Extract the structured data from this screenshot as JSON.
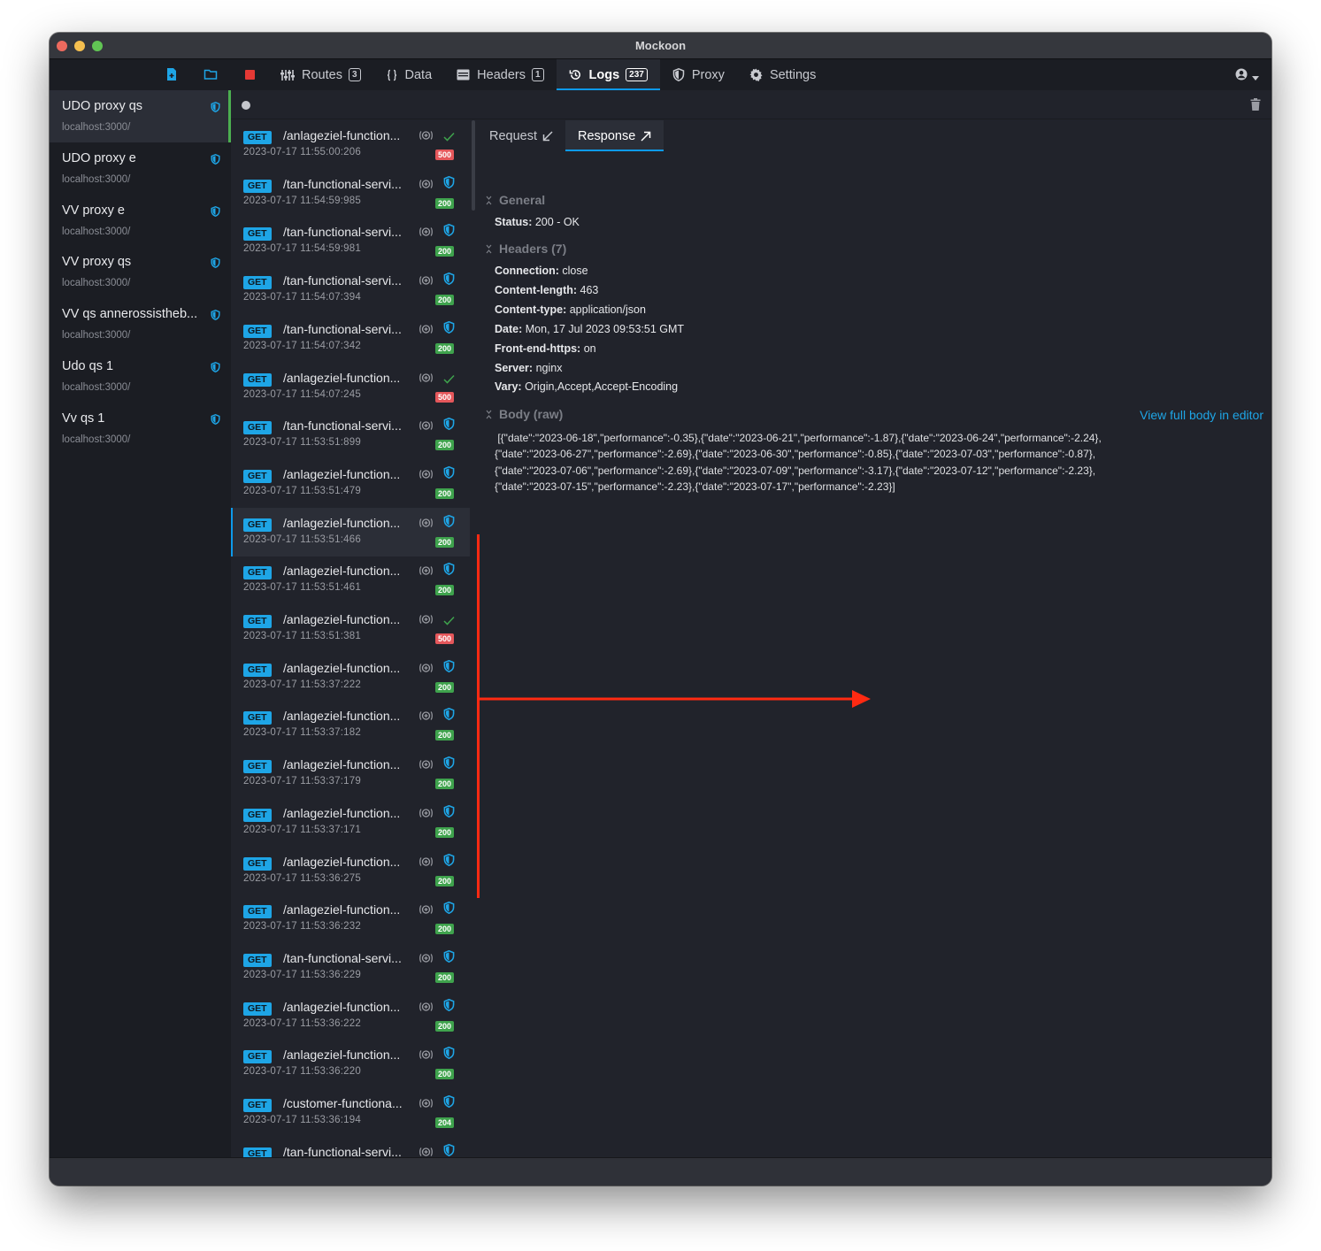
{
  "app": {
    "title": "Mockoon"
  },
  "nav": {
    "routes": {
      "label": "Routes",
      "count": "3"
    },
    "data": {
      "label": "Data"
    },
    "headers": {
      "label": "Headers",
      "count": "1"
    },
    "logs": {
      "label": "Logs",
      "count": "237"
    },
    "proxy": {
      "label": "Proxy"
    },
    "settings": {
      "label": "Settings"
    }
  },
  "environments": [
    {
      "name": "UDO proxy qs",
      "url": "localhost:3000/"
    },
    {
      "name": "UDO proxy e",
      "url": "localhost:3000/"
    },
    {
      "name": "VV proxy e",
      "url": "localhost:3000/"
    },
    {
      "name": "VV proxy qs",
      "url": "localhost:3000/"
    },
    {
      "name": "VV qs annerossistheb...",
      "url": "localhost:3000/"
    },
    {
      "name": "Udo qs 1",
      "url": "localhost:3000/"
    },
    {
      "name": "Vv qs 1",
      "url": "localhost:3000/"
    }
  ],
  "logs": [
    {
      "method": "GET",
      "route": "/anlageziel-function...",
      "ts": "2023-07-17 11:55:00:206",
      "status": "500",
      "state": "check"
    },
    {
      "method": "GET",
      "route": "/tan-functional-servi...",
      "ts": "2023-07-17 11:54:59:985",
      "status": "200",
      "state": "shield"
    },
    {
      "method": "GET",
      "route": "/tan-functional-servi...",
      "ts": "2023-07-17 11:54:59:981",
      "status": "200",
      "state": "shield"
    },
    {
      "method": "GET",
      "route": "/tan-functional-servi...",
      "ts": "2023-07-17 11:54:07:394",
      "status": "200",
      "state": "shield"
    },
    {
      "method": "GET",
      "route": "/tan-functional-servi...",
      "ts": "2023-07-17 11:54:07:342",
      "status": "200",
      "state": "shield"
    },
    {
      "method": "GET",
      "route": "/anlageziel-function...",
      "ts": "2023-07-17 11:54:07:245",
      "status": "500",
      "state": "check"
    },
    {
      "method": "GET",
      "route": "/tan-functional-servi...",
      "ts": "2023-07-17 11:53:51:899",
      "status": "200",
      "state": "shield"
    },
    {
      "method": "GET",
      "route": "/anlageziel-function...",
      "ts": "2023-07-17 11:53:51:479",
      "status": "200",
      "state": "shield"
    },
    {
      "method": "GET",
      "route": "/anlageziel-function...",
      "ts": "2023-07-17 11:53:51:466",
      "status": "200",
      "state": "shield"
    },
    {
      "method": "GET",
      "route": "/anlageziel-function...",
      "ts": "2023-07-17 11:53:51:461",
      "status": "200",
      "state": "shield"
    },
    {
      "method": "GET",
      "route": "/anlageziel-function...",
      "ts": "2023-07-17 11:53:51:381",
      "status": "500",
      "state": "check"
    },
    {
      "method": "GET",
      "route": "/anlageziel-function...",
      "ts": "2023-07-17 11:53:37:222",
      "status": "200",
      "state": "shield"
    },
    {
      "method": "GET",
      "route": "/anlageziel-function...",
      "ts": "2023-07-17 11:53:37:182",
      "status": "200",
      "state": "shield"
    },
    {
      "method": "GET",
      "route": "/anlageziel-function...",
      "ts": "2023-07-17 11:53:37:179",
      "status": "200",
      "state": "shield"
    },
    {
      "method": "GET",
      "route": "/anlageziel-function...",
      "ts": "2023-07-17 11:53:37:171",
      "status": "200",
      "state": "shield"
    },
    {
      "method": "GET",
      "route": "/anlageziel-function...",
      "ts": "2023-07-17 11:53:36:275",
      "status": "200",
      "state": "shield"
    },
    {
      "method": "GET",
      "route": "/anlageziel-function...",
      "ts": "2023-07-17 11:53:36:232",
      "status": "200",
      "state": "shield"
    },
    {
      "method": "GET",
      "route": "/tan-functional-servi...",
      "ts": "2023-07-17 11:53:36:229",
      "status": "200",
      "state": "shield"
    },
    {
      "method": "GET",
      "route": "/anlageziel-function...",
      "ts": "2023-07-17 11:53:36:222",
      "status": "200",
      "state": "shield"
    },
    {
      "method": "GET",
      "route": "/anlageziel-function...",
      "ts": "2023-07-17 11:53:36:220",
      "status": "200",
      "state": "shield"
    },
    {
      "method": "GET",
      "route": "/customer-functiona...",
      "ts": "2023-07-17 11:53:36:194",
      "status": "204",
      "state": "shield"
    },
    {
      "method": "GET",
      "route": "/tan-functional-servi...",
      "ts": "",
      "status": "",
      "state": "shield"
    }
  ],
  "detail": {
    "tabs": {
      "request": "Request",
      "response": "Response"
    },
    "general": {
      "title": "General",
      "status_key": "Status:",
      "status_val": "200 - OK"
    },
    "headers": {
      "title": "Headers (7)",
      "items": [
        {
          "k": "Connection:",
          "v": "close"
        },
        {
          "k": "Content-length:",
          "v": "463"
        },
        {
          "k": "Content-type:",
          "v": "application/json"
        },
        {
          "k": "Date:",
          "v": "Mon, 17 Jul 2023 09:53:51 GMT"
        },
        {
          "k": "Front-end-https:",
          "v": "on"
        },
        {
          "k": "Server:",
          "v": "nginx"
        },
        {
          "k": "Vary:",
          "v": "Origin,Accept,Accept-Encoding"
        }
      ]
    },
    "body": {
      "title": "Body (raw)",
      "link": "View full body in editor",
      "raw": " [{\"date\":\"2023-06-18\",\"performance\":-0.35},{\"date\":\"2023-06-21\",\"performance\":-1.87},{\"date\":\"2023-06-24\",\"performance\":-2.24},\n{\"date\":\"2023-06-27\",\"performance\":-2.69},{\"date\":\"2023-06-30\",\"performance\":-0.85},{\"date\":\"2023-07-03\",\"performance\":-0.87},\n{\"date\":\"2023-07-06\",\"performance\":-2.69},{\"date\":\"2023-07-09\",\"performance\":-3.17},{\"date\":\"2023-07-12\",\"performance\":-2.23},\n{\"date\":\"2023-07-15\",\"performance\":-2.23},{\"date\":\"2023-07-17\",\"performance\":-2.23}]"
    }
  },
  "colors": {
    "accent": "#0d9aeb",
    "active_env": "#4caf50",
    "annotation": "#ff2a12",
    "status_ok": "#3fa34d",
    "status_err": "#e5575b"
  }
}
